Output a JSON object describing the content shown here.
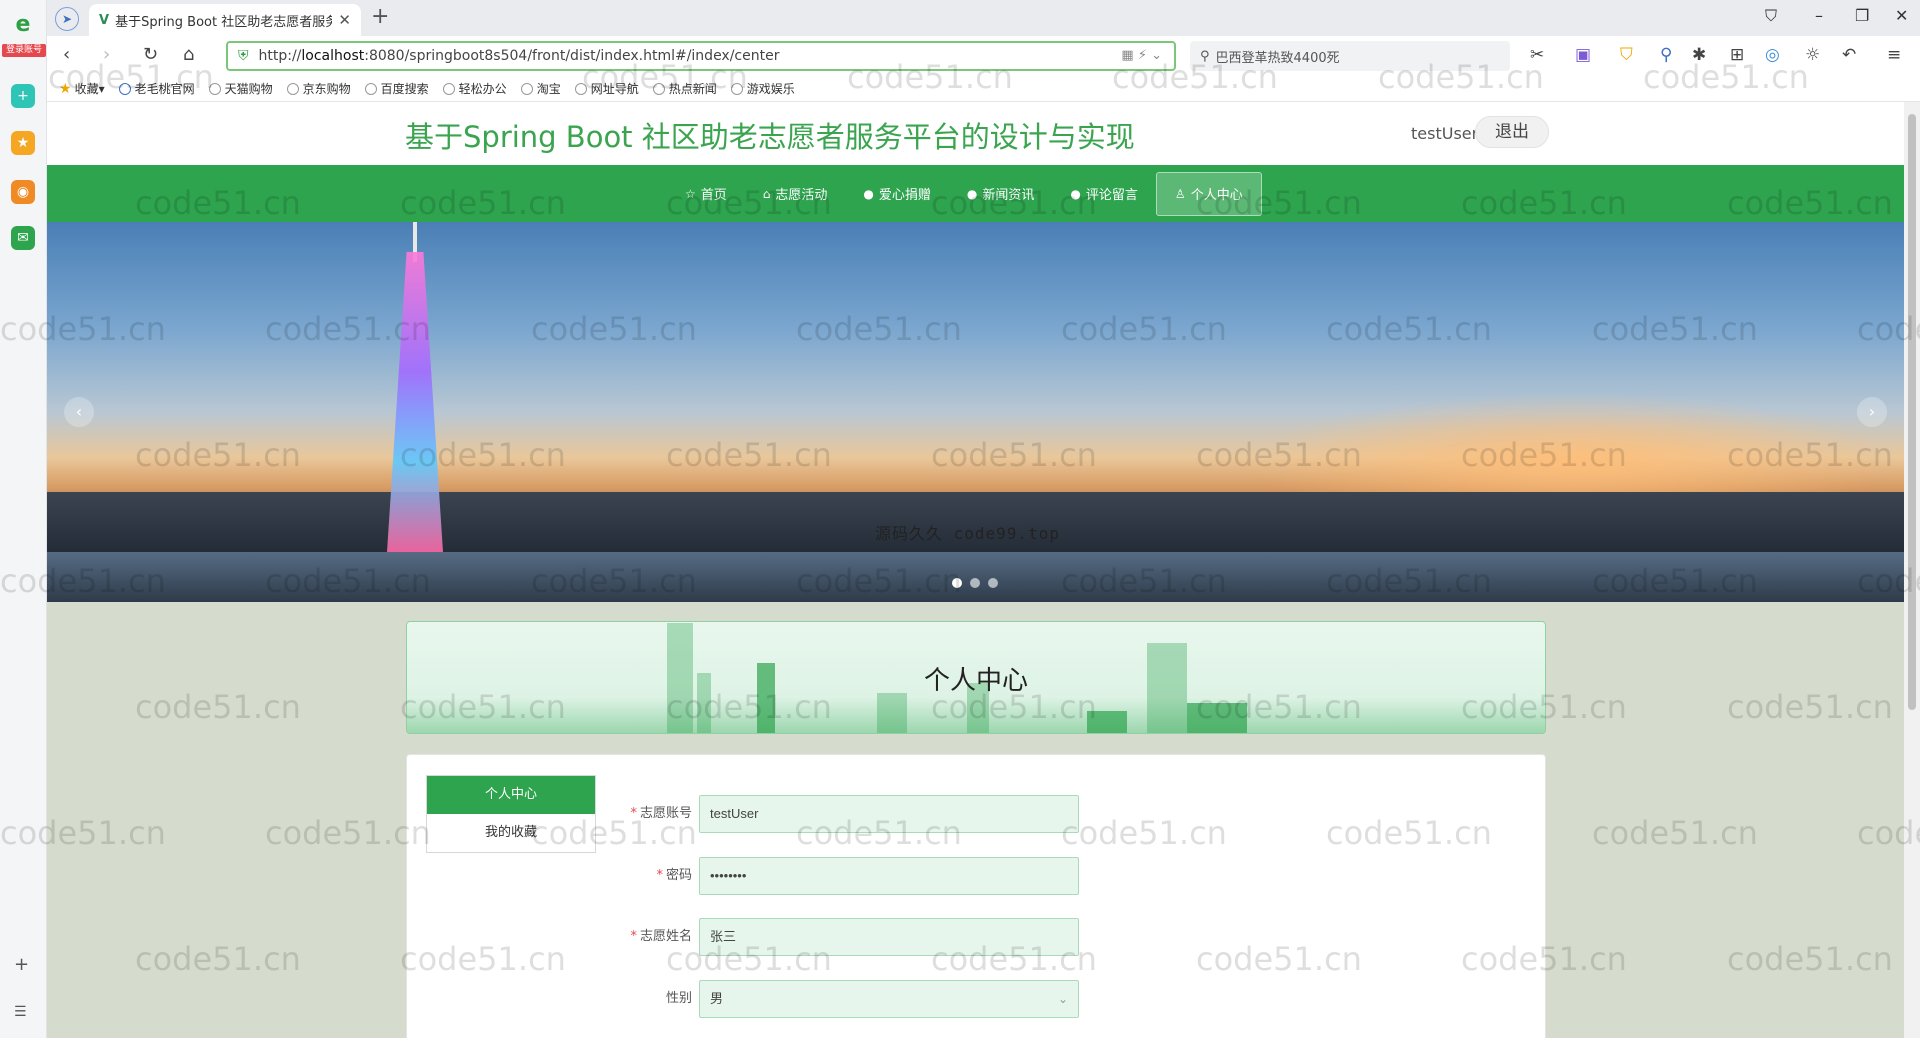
{
  "side_strip": {
    "badge": "登录账号"
  },
  "tab": {
    "title": "基于Spring Boot 社区助老志愿者服务平台的设计与实现"
  },
  "address": {
    "url_prefix": "http://",
    "url_host": "localhost",
    "url_rest": ":8080/springboot8s504/front/dist/index.html#/index/center",
    "search_text": "巴西登革热致4400死"
  },
  "bookmarks": [
    {
      "label": "收藏"
    },
    {
      "label": "老毛桃官网"
    },
    {
      "label": "天猫购物"
    },
    {
      "label": "京东购物"
    },
    {
      "label": "百度搜索"
    },
    {
      "label": "轻松办公"
    },
    {
      "label": "淘宝"
    },
    {
      "label": "网址导航"
    },
    {
      "label": "热点新闻"
    },
    {
      "label": "游戏娱乐"
    }
  ],
  "site": {
    "title": "基于Spring Boot 社区助老志愿者服务平台的设计与实现",
    "username": "testUser",
    "logout": "退出"
  },
  "nav": [
    {
      "label": "首页",
      "icon": "☆"
    },
    {
      "label": "志愿活动",
      "icon": "⌂"
    },
    {
      "label": "爱心捐赠",
      "icon": "●"
    },
    {
      "label": "新闻资讯",
      "icon": "●"
    },
    {
      "label": "评论留言",
      "icon": "●"
    },
    {
      "label": "个人中心",
      "icon": "♙"
    }
  ],
  "banner": {
    "caption": "源码久久 code99.top",
    "current_slide": 1,
    "slide_count": 3
  },
  "section": {
    "title": "个人中心"
  },
  "side_menu": [
    {
      "label": "个人中心"
    },
    {
      "label": "我的收藏"
    }
  ],
  "form": {
    "account": {
      "label": "志愿账号",
      "value": "testUser"
    },
    "password": {
      "label": "密码",
      "value": "••••••••"
    },
    "name": {
      "label": "志愿姓名",
      "value": "张三"
    },
    "gender": {
      "label": "性别",
      "value": "男"
    }
  },
  "watermark": "code51.cn"
}
